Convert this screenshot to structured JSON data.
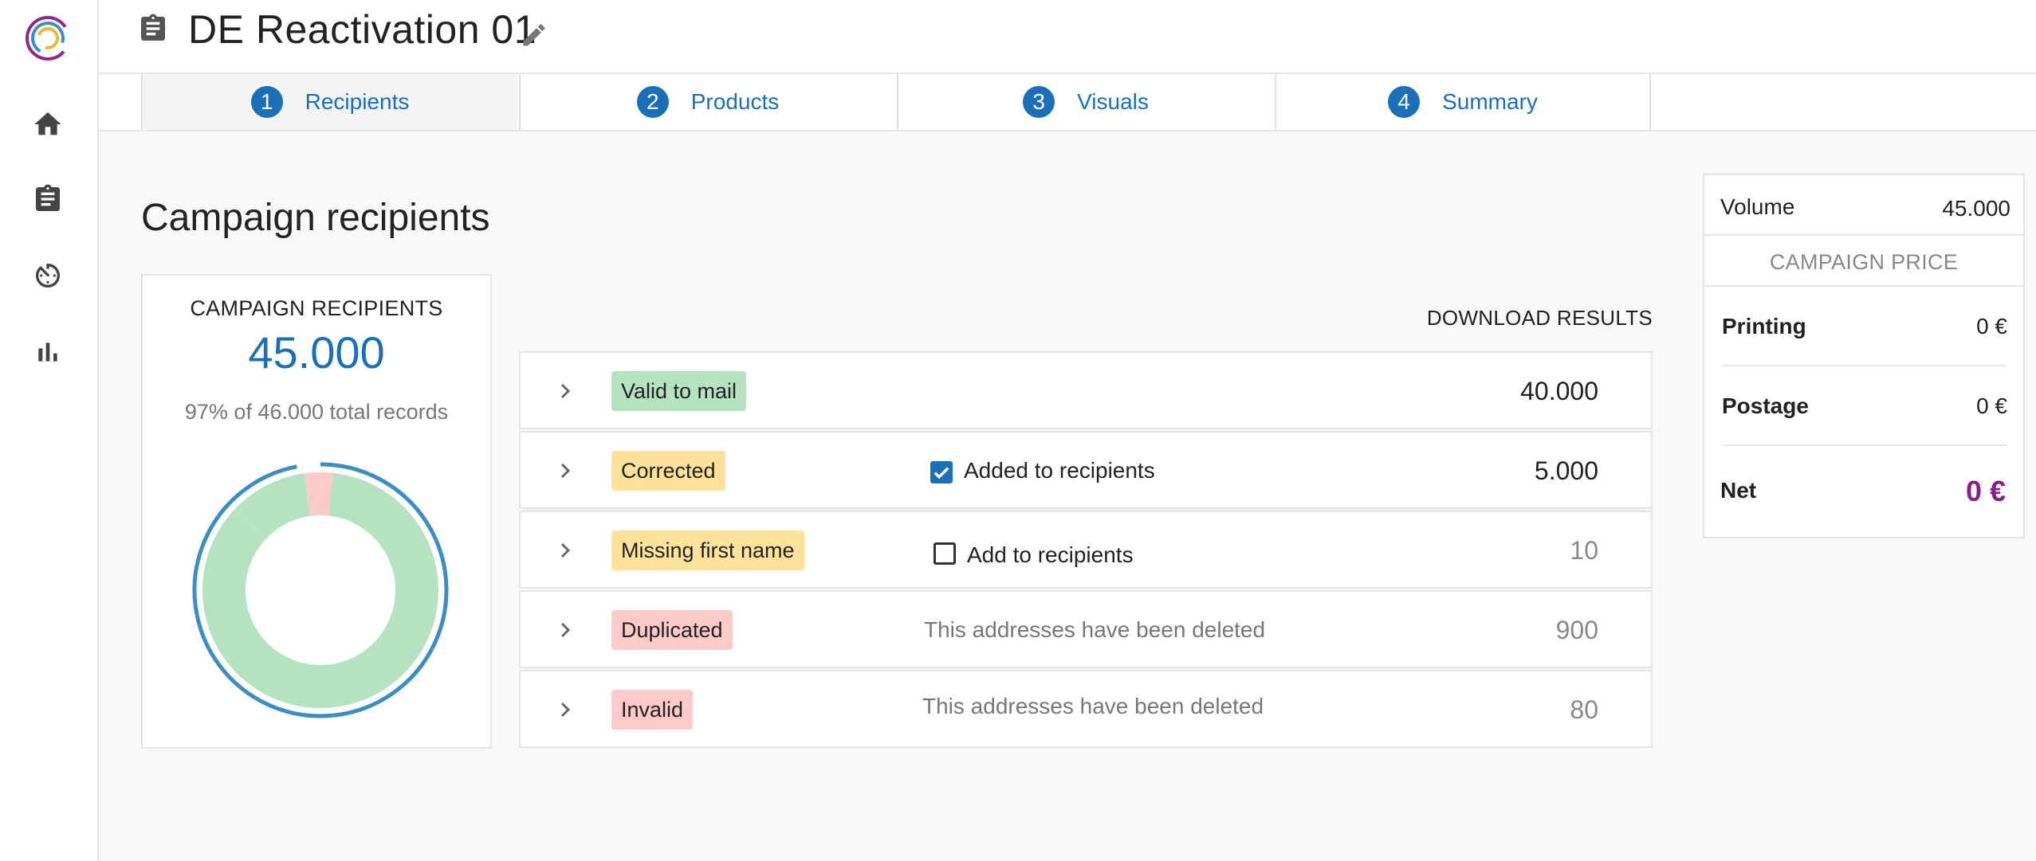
{
  "header": {
    "title": "DE Reactivation 01"
  },
  "sidebar": {
    "items": [
      {
        "name": "home",
        "icon": "home-icon"
      },
      {
        "name": "campaigns",
        "icon": "clipboard-icon"
      },
      {
        "name": "history",
        "icon": "timer-icon"
      },
      {
        "name": "reports",
        "icon": "bar-chart-icon"
      }
    ]
  },
  "tabs": [
    {
      "number": "1",
      "label": "Recipients",
      "active": true
    },
    {
      "number": "2",
      "label": "Products",
      "active": false
    },
    {
      "number": "3",
      "label": "Visuals",
      "active": false
    },
    {
      "number": "4",
      "label": "Summary",
      "active": false
    }
  ],
  "main": {
    "title": "Campaign recipients",
    "summary": {
      "label": "CAMPAIGN RECIPIENTS",
      "value": "45.000",
      "subtitle": "97% of 46.000 total records",
      "donut": {
        "segments": [
          {
            "name": "valid",
            "value": 40000,
            "color": "#b5e2c0"
          },
          {
            "name": "corrected",
            "value": 5000,
            "color": "#b5e2c0"
          },
          {
            "name": "missing",
            "value": 10,
            "color": "#fde39a"
          },
          {
            "name": "duplicated",
            "value": 900,
            "color": "#fdc9c9"
          },
          {
            "name": "invalid",
            "value": 80,
            "color": "#fdc9c9"
          }
        ],
        "ring_color": "#3b8dc5"
      }
    },
    "download_label": "DOWNLOAD RESULTS",
    "results": [
      {
        "badge": "Valid to mail",
        "color": "green",
        "note": "",
        "checkbox": null,
        "count": "40.000",
        "muted": false
      },
      {
        "badge": "Corrected",
        "color": "yellow",
        "note": "",
        "checkbox": {
          "checked": true,
          "label": "Added to recipients"
        },
        "count": "5.000",
        "muted": false
      },
      {
        "badge": "Missing first name",
        "color": "yellow",
        "note": "",
        "checkbox": {
          "checked": false,
          "label": "Add to recipients"
        },
        "count": "10",
        "muted": true
      },
      {
        "badge": "Duplicated",
        "color": "red",
        "note": "This addresses have been deleted",
        "checkbox": null,
        "count": "900",
        "muted": true
      },
      {
        "badge": "Invalid",
        "color": "red",
        "note": "This addresses have been deleted",
        "checkbox": null,
        "count": "80",
        "muted": true
      }
    ]
  },
  "price": {
    "volume_label": "Volume",
    "volume_value": "45.000",
    "header": "CAMPAIGN PRICE",
    "printing_label": "Printing",
    "printing_value": "0 €",
    "postage_label": "Postage",
    "postage_value": "0 €",
    "net_label": "Net",
    "net_value": "0 €",
    "net_color": "#8b1d86"
  }
}
